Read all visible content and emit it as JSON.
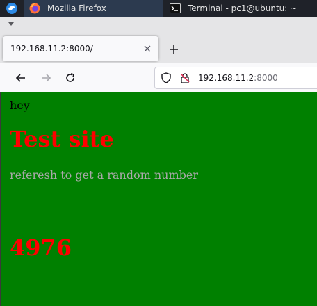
{
  "taskbar": {
    "tasks": [
      {
        "label": "Mozilla Firefox",
        "icon": "firefox-icon"
      },
      {
        "label": "Terminal - pc1@ubuntu: ~",
        "icon": "terminal-icon"
      }
    ]
  },
  "browser": {
    "tab": {
      "title": "192.168.11.2:8000/"
    },
    "url": {
      "host": "192.168.11.2",
      "port": ":8000"
    }
  },
  "page": {
    "greeting": "hey",
    "title": "Test site",
    "subtitle": "referesh to get a random number",
    "random_number": "4976",
    "colors": {
      "background": "#008000",
      "title": "#ff0000",
      "subtitle": "#a9a9a9",
      "greeting": "#000000"
    }
  }
}
